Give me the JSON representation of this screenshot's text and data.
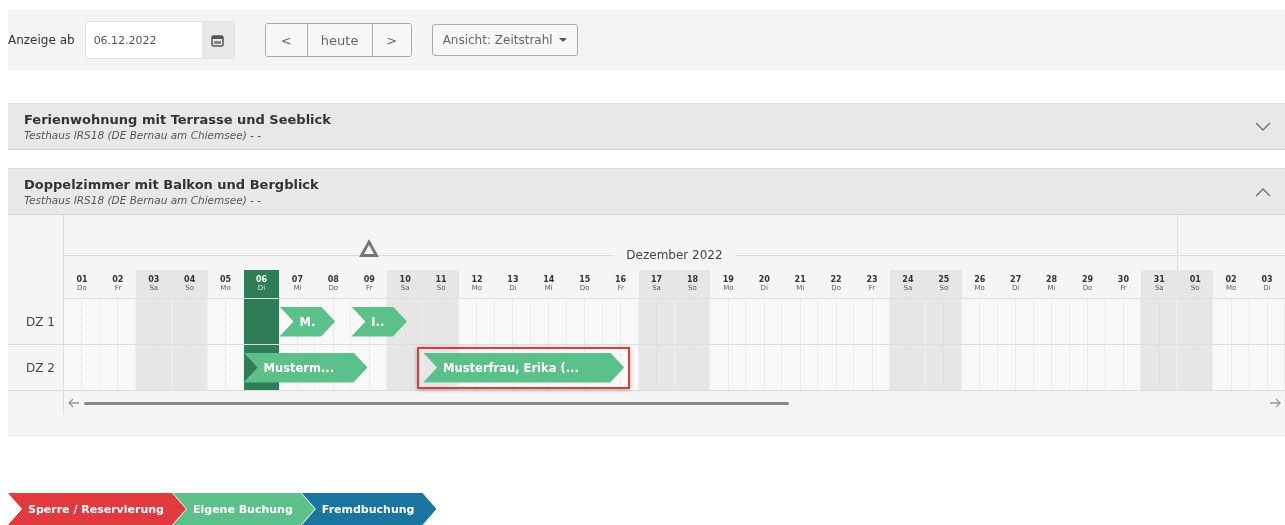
{
  "toolbar": {
    "label": "Anzeige ab",
    "date_value": "06.12.2022",
    "prev": "<",
    "today": "heute",
    "next": ">",
    "view": "Ansicht: Zeitstrahl"
  },
  "sections": [
    {
      "title": "Ferienwohnung mit Terrasse und Seeblick",
      "subtitle": "Testhaus IRS18 (DE Bernau am Chiemsee) - -",
      "expanded": false
    },
    {
      "title": "Doppelzimmer mit Balkon und Bergblick",
      "subtitle": "Testhaus IRS18 (DE Bernau am Chiemsee) - -",
      "expanded": true
    }
  ],
  "timeline": {
    "month": "Dezember 2022",
    "days": [
      {
        "date": "01",
        "weekday": "Do",
        "weekend": false,
        "today": false
      },
      {
        "date": "02",
        "weekday": "Fr",
        "weekend": false,
        "today": false
      },
      {
        "date": "03",
        "weekday": "Sa",
        "weekend": true,
        "today": false
      },
      {
        "date": "04",
        "weekday": "So",
        "weekend": true,
        "today": false
      },
      {
        "date": "05",
        "weekday": "Mo",
        "weekend": false,
        "today": false
      },
      {
        "date": "06",
        "weekday": "Di",
        "weekend": false,
        "today": true
      },
      {
        "date": "07",
        "weekday": "Mi",
        "weekend": false,
        "today": false
      },
      {
        "date": "08",
        "weekday": "Do",
        "weekend": false,
        "today": false
      },
      {
        "date": "09",
        "weekday": "Fr",
        "weekend": false,
        "today": false
      },
      {
        "date": "10",
        "weekday": "Sa",
        "weekend": true,
        "today": false
      },
      {
        "date": "11",
        "weekday": "So",
        "weekend": true,
        "today": false
      },
      {
        "date": "12",
        "weekday": "Mo",
        "weekend": false,
        "today": false
      },
      {
        "date": "13",
        "weekday": "Di",
        "weekend": false,
        "today": false
      },
      {
        "date": "14",
        "weekday": "Mi",
        "weekend": false,
        "today": false
      },
      {
        "date": "15",
        "weekday": "Do",
        "weekend": false,
        "today": false
      },
      {
        "date": "16",
        "weekday": "Fr",
        "weekend": false,
        "today": false
      },
      {
        "date": "17",
        "weekday": "Sa",
        "weekend": true,
        "today": false
      },
      {
        "date": "18",
        "weekday": "So",
        "weekend": true,
        "today": false
      },
      {
        "date": "19",
        "weekday": "Mo",
        "weekend": false,
        "today": false
      },
      {
        "date": "20",
        "weekday": "Di",
        "weekend": false,
        "today": false
      },
      {
        "date": "21",
        "weekday": "Mi",
        "weekend": false,
        "today": false
      },
      {
        "date": "22",
        "weekday": "Do",
        "weekend": false,
        "today": false
      },
      {
        "date": "23",
        "weekday": "Fr",
        "weekend": false,
        "today": false
      },
      {
        "date": "24",
        "weekday": "Sa",
        "weekend": true,
        "today": false
      },
      {
        "date": "25",
        "weekday": "So",
        "weekend": true,
        "today": false
      },
      {
        "date": "26",
        "weekday": "Mo",
        "weekend": false,
        "today": false
      },
      {
        "date": "27",
        "weekday": "Di",
        "weekend": false,
        "today": false
      },
      {
        "date": "28",
        "weekday": "Mi",
        "weekend": false,
        "today": false
      },
      {
        "date": "29",
        "weekday": "Do",
        "weekend": false,
        "today": false
      },
      {
        "date": "30",
        "weekday": "Fr",
        "weekend": false,
        "today": false
      },
      {
        "date": "31",
        "weekday": "Sa",
        "weekend": true,
        "today": false
      },
      {
        "date": "01",
        "weekday": "So",
        "weekend": true,
        "today": false
      },
      {
        "date": "02",
        "weekday": "Mo",
        "weekend": false,
        "today": false
      },
      {
        "date": "03",
        "weekday": "Di",
        "weekend": false,
        "today": false
      }
    ],
    "rooms": [
      {
        "name": "DZ 1",
        "bookings": [
          {
            "label": "M.",
            "selected": false
          },
          {
            "label": "I..",
            "selected": false
          }
        ]
      },
      {
        "name": "DZ 2",
        "bookings": [
          {
            "label": "Musterm...",
            "selected": false
          },
          {
            "label": "Musterfrau, Erika (...",
            "selected": true
          }
        ]
      }
    ]
  },
  "legend": [
    {
      "label": "Sperre / Reservierung",
      "color": "#e0393e"
    },
    {
      "label": "Eigene Buchung",
      "color": "#5cc08a"
    },
    {
      "label": "Fremdbuchung",
      "color": "#1a75a0"
    }
  ]
}
